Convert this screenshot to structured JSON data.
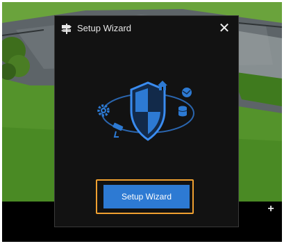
{
  "dialog": {
    "title": "Setup Wizard",
    "close_glyph": "✕",
    "icon": "signpost-icon",
    "primary_button_label": "Setup Wizard",
    "illustration_icons": [
      "shield-icon",
      "gear-icon",
      "camera-icon",
      "house-icon",
      "globe-icon",
      "database-icon"
    ]
  },
  "live_view": {
    "add_glyph": "+"
  },
  "colors": {
    "accent": "#2d7ad3",
    "focus_frame": "#f0a030",
    "dialog_bg": "#121212"
  }
}
